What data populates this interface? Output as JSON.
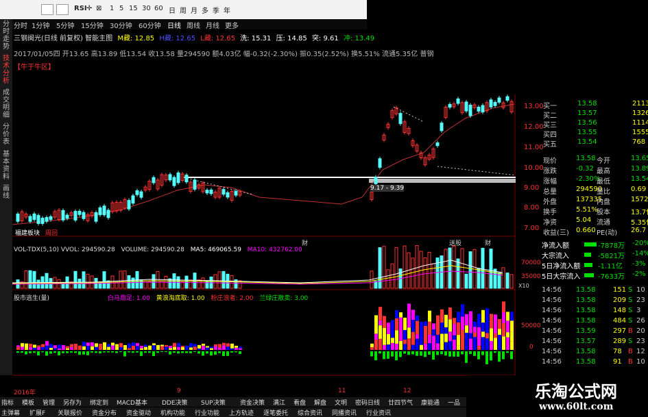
{
  "toolbar": {
    "buttons": [
      "RSI",
      "1",
      "5",
      "15",
      "30",
      "60",
      "日",
      "周",
      "月",
      "多",
      "季",
      "年"
    ]
  },
  "leftnav": [
    "分时走势",
    "技术分析",
    "成交明细",
    "分价表",
    "基本资料",
    "画线"
  ],
  "periods": [
    "分时",
    "1分钟",
    "5分钟",
    "15分钟",
    "30分钟",
    "60分钟",
    "日线",
    "周线",
    "月线",
    "更多"
  ],
  "header": {
    "line1": "三钢闽光(日线 前复权) 智能主图",
    "mwave": "M藏: 12.85",
    "hwave": "H藏: 12.65",
    "lwave": "L藏: 12.65",
    "wash": "洗: 15.31",
    "pressure": "压: 14.85",
    "tu": "突: 9.61",
    "chong": "冲: 13.49",
    "line2": "2017/01/05四 开13.65 高13.89 低13.54 收13.58 量294590 额4.03亿 幅-0.32(-2.30%) 振0.35(2.52%) 换5.51% 流通5.35亿 普钢",
    "tag": "【牛于牛区】"
  },
  "chart": {
    "price_axis": [
      "13.00",
      "12.00",
      "11.00",
      "10.00",
      "9.00",
      "8.00",
      "7.00"
    ],
    "box_label": "9.17 - 9.39",
    "left_label": "福建板块",
    "left_label2": "周回",
    "vol_title": "VOL-TDX(5,10) VVOL: 294590.28",
    "vol_volume": "VOLUME: 294590.28",
    "vol_ma5": "MA5: 469065.59",
    "vol_ma10": "MA10: 432762.00",
    "vol_axis": [
      "70000",
      "35000",
      "X10"
    ],
    "ind_title": "股市逃生(量)",
    "ind_params": [
      "白马鼎足: 1.00",
      "黄浪淘底取: 1.00",
      "粉庄浪者: 2.00",
      "兰绿庄散卖: 3.00"
    ],
    "ind_axis": [
      "50000",
      "0"
    ],
    "date_axis": [
      "2016年",
      "9",
      "11",
      "12",
      "1"
    ],
    "markers": [
      "财",
      "送股",
      "财"
    ]
  },
  "quote": {
    "book": [
      {
        "label": "买一",
        "price": "13.58",
        "vol": "2113"
      },
      {
        "label": "买二",
        "price": "13.57",
        "vol": "1326"
      },
      {
        "label": "买三",
        "price": "13.56",
        "vol": "1114"
      },
      {
        "label": "买四",
        "price": "13.55",
        "vol": "1555"
      },
      {
        "label": "买五",
        "price": "13.54",
        "vol": "768"
      }
    ],
    "stats": [
      {
        "l": "现价",
        "v": "13.58",
        "l2": "今开",
        "v2": "13.65"
      },
      {
        "l": "涨跌",
        "v": "-0.32",
        "l2": "最高",
        "v2": "13.89"
      },
      {
        "l": "涨幅",
        "v": "-2.30%",
        "l2": "最低",
        "v2": "13.54"
      },
      {
        "l": "总量",
        "v": "294590",
        "l2": "量比",
        "v2": "0.69"
      },
      {
        "l": "外盘",
        "v": "137335",
        "l2": "内盘",
        "v2": "157255"
      },
      {
        "l": "换手",
        "v": "5.51%",
        "l2": "股本",
        "v2": "13.7亿"
      },
      {
        "l": "净资",
        "v": "5.04",
        "l2": "流通",
        "v2": "5.35亿"
      },
      {
        "l": "收益(三)",
        "v": "0.660",
        "l2": "PE(动)",
        "v2": "26.7"
      }
    ],
    "flows": [
      {
        "l": "净流入额",
        "v": "-7878万",
        "p": "-20%"
      },
      {
        "l": "大宗流入",
        "v": "-5821万",
        "p": "-14%"
      },
      {
        "l": "5日净流入额",
        "v": "-1.11亿",
        "p": "-3%"
      },
      {
        "l": "5日大宗流入",
        "v": "-7633万",
        "p": "-2%"
      }
    ],
    "ticks": [
      {
        "t": "14:56",
        "p": "13.58",
        "v": "151",
        "s": "S",
        "n": "10"
      },
      {
        "t": "14:56",
        "p": "13.58",
        "v": "209",
        "s": "S",
        "n": "23"
      },
      {
        "t": "14:56",
        "p": "13.58",
        "v": "148",
        "s": "S",
        "n": "3"
      },
      {
        "t": "14:56",
        "p": "13.58",
        "v": "484",
        "s": "S",
        "n": "26"
      },
      {
        "t": "14:56",
        "p": "13.59",
        "v": "297",
        "s": "B",
        "n": "20"
      },
      {
        "t": "14:56",
        "p": "13.57",
        "v": "289",
        "s": "S",
        "n": "23"
      },
      {
        "t": "14:56",
        "p": "13.58",
        "v": "78",
        "s": "B",
        "n": "12"
      },
      {
        "t": "14:56",
        "p": "13.58",
        "v": "91",
        "s": "B",
        "n": "10"
      }
    ]
  },
  "bottom_tabs1": [
    "指标",
    "模板",
    "管理",
    "另存为",
    "绑定到",
    "MACD基本",
    "DDE决策",
    "SUP决策",
    "资金决策",
    "满江",
    "看盘",
    "解盘",
    "文明",
    "密码日线",
    "廿四节气",
    "康能通",
    "一品",
    "般灵决策",
    "ZC",
    "多空对比",
    "农林"
  ],
  "bottom_tabs2": [
    "主弹幕",
    "扩展F",
    "关联报价",
    "资金分布",
    "资金驱动",
    "机构功能",
    "行业功能",
    "上方轨迹",
    "逐笔委托",
    "综合资讯",
    "同播资讯",
    "行业资讯"
  ],
  "watermark": {
    "title": "乐淘公式网",
    "url": "www.60lt.com"
  },
  "colors": {
    "up": "#ff3232",
    "down": "#54fcfc",
    "magenta": "#ff00ff",
    "yellow": "#ffff00",
    "green": "#00e000",
    "white": "#ffffff"
  }
}
